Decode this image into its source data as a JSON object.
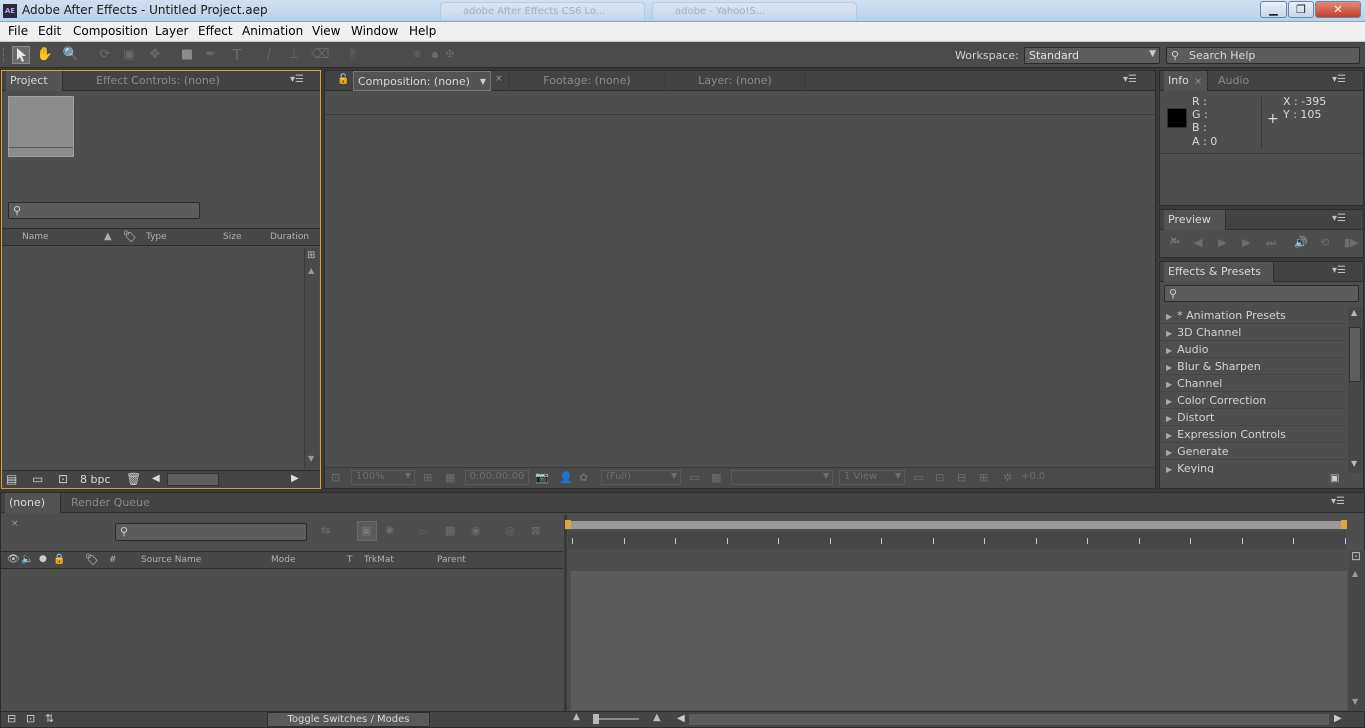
{
  "window": {
    "title": "Adobe After Effects - Untitled Project.aep",
    "logo_text": "AE",
    "minimize": "▁",
    "restore": "❐",
    "close": "✕"
  },
  "bg_tabs": [
    "adobe After Effects CS6 Lo...",
    "adobe - Yahoo!S..."
  ],
  "menu": [
    "File",
    "Edit",
    "Composition",
    "Layer",
    "Effect",
    "Animation",
    "View",
    "Window",
    "Help"
  ],
  "tools": {
    "selection": "selection-tool-icon",
    "hand": "hand-tool-icon",
    "zoom": "zoom-tool-icon",
    "rotate": "rotate-tool-icon",
    "camera": "camera-tool-icon",
    "pan_behind": "pan-behind-tool-icon",
    "shape": "rectangle-tool-icon",
    "pen": "pen-tool-icon",
    "type": "type-tool-icon",
    "brush": "brush-tool-icon",
    "clone": "clone-stamp-tool-icon",
    "eraser": "eraser-tool-icon",
    "puppet": "puppet-tool-icon"
  },
  "workspace": {
    "label": "Workspace:",
    "value": "Standard"
  },
  "search_help": {
    "placeholder": "Search Help"
  },
  "project_panel": {
    "tabs": [
      "Project",
      "Effect Controls: (none)"
    ],
    "columns": [
      "Name",
      "Type",
      "Size",
      "Duration"
    ],
    "bpc": "8 bpc"
  },
  "composition_panel": {
    "tabs": [
      "Composition: (none)",
      "Footage: (none)",
      "Layer: (none)"
    ],
    "footer": {
      "zoom": "100%",
      "timecode": "0:00:00:00",
      "resolution": "(Full)",
      "views": "1 View",
      "exposure": "+0.0"
    }
  },
  "info_panel": {
    "tabs": [
      "Info",
      "Audio"
    ],
    "channels": [
      "R :",
      "G :",
      "B :",
      "A : 0"
    ],
    "x": "X : -395",
    "y": "Y : 105",
    "swatch_color": "#000000"
  },
  "preview_panel": {
    "tab": "Preview"
  },
  "effects_panel": {
    "tab": "Effects & Presets",
    "items": [
      "* Animation Presets",
      "3D Channel",
      "Audio",
      "Blur & Sharpen",
      "Channel",
      "Color Correction",
      "Distort",
      "Expression Controls",
      "Generate",
      "Keying"
    ]
  },
  "timeline": {
    "tabs": [
      "(none)",
      "Render Queue"
    ],
    "columns": [
      "#",
      "Source Name",
      "Mode",
      "T",
      "TrkMat",
      "Parent"
    ],
    "toggle_label": "Toggle Switches / Modes"
  },
  "colors": {
    "panel": "#4e4e4e",
    "accent": "#e1a53b",
    "focus_border": "#d6a02a"
  }
}
